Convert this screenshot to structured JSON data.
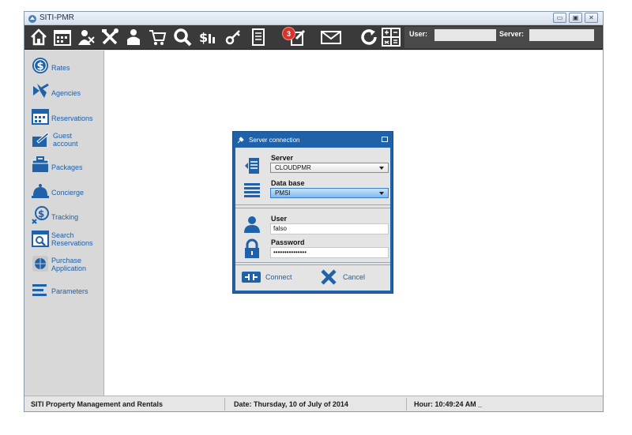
{
  "window": {
    "title": "SITI-PMR",
    "controls": {
      "minimize": "▭",
      "restore": "▣",
      "close": "✕"
    }
  },
  "toolbar": {
    "icons": [
      "home-icon",
      "calendar-icon",
      "agencies-icon",
      "tools-icon",
      "person-icon",
      "cart-icon",
      "search-icon",
      "money-icon",
      "keys-icon",
      "document-icon",
      "notification-icon",
      "mail-icon",
      "refresh-icon",
      "calculator-icon"
    ],
    "notification_count": "3",
    "user_label": "User:",
    "user_value": "",
    "server_label": "Server:",
    "server_value": ""
  },
  "sidebar": {
    "items": [
      {
        "label": "Rates",
        "icon": "dollar-icon"
      },
      {
        "label": "Agencies",
        "icon": "plane-icon"
      },
      {
        "label": "Reservations",
        "icon": "calendar-icon"
      },
      {
        "label": "Guest account",
        "line1": "Guest",
        "line2": "account",
        "icon": "guest-account-icon"
      },
      {
        "label": "Packages",
        "icon": "package-icon"
      },
      {
        "label": "Concierge",
        "icon": "bell-icon"
      },
      {
        "label": "Tracking",
        "icon": "tracking-icon"
      },
      {
        "label": "Search Reservations",
        "line1": "Search",
        "line2": "Reservations",
        "icon": "search-calendar-icon"
      },
      {
        "label": "Purchase Application",
        "line1": "Purchase",
        "line2": "Application",
        "icon": "globe-icon"
      },
      {
        "label": "Parameters",
        "icon": "list-icon"
      }
    ]
  },
  "dialog": {
    "title": "Server connection",
    "server_label": "Server",
    "server_value": "CLOUDPMR",
    "database_label": "Data base",
    "database_value": "PMSI",
    "user_label": "User",
    "user_value": "falso",
    "password_label": "Password",
    "password_value": "•••••••••••••••",
    "connect_label": "Connect",
    "cancel_label": "Cancel"
  },
  "status": {
    "app_name": "SITI Property Management and Rentals",
    "date": "Date:  Thursday, 10 of  July of 2014",
    "hour": "Hour:  10:49:24 AM _"
  },
  "colors": {
    "toolbar_bg": "#3a3a3a",
    "accent_blue": "#1f62a9",
    "label_blue": "#1f5fa8",
    "badge_red": "#d8322c",
    "sidebar_bg": "#d8d8d8"
  }
}
